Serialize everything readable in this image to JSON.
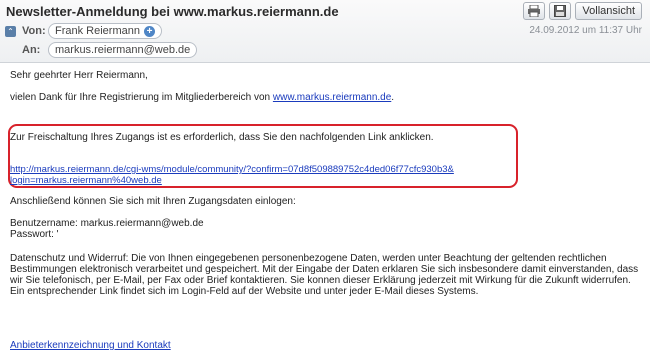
{
  "header": {
    "subject": "Newsletter-Anmeldung bei www.markus.reiermann.de",
    "print_icon": "printer-icon",
    "save_icon": "save-icon",
    "fullview_label": "Vollansicht",
    "von_label": "Von:",
    "sender": "Frank Reiermann",
    "an_label": "An:",
    "recipient": "markus.reiermann@web.de",
    "date": "24.09.2012 um 11:37 Uhr"
  },
  "body": {
    "salutation": "Sehr geehrter Herr Reiermann,",
    "thanks_prefix": "vielen Dank für Ihre Registrierung im Mitgliederbereich von ",
    "thanks_link": "www.markus.reiermann.de",
    "thanks_suffix": ".",
    "activation_text": "Zur Freischaltung Ihres Zugangs ist es erforderlich, dass Sie den nachfolgenden Link anklicken.",
    "activation_link_line1": "http://markus.reiermann.de/cgi-wms/module/community/?confirm=07d8f509889752c4ded06f77cfc930b3&",
    "activation_link_line2": "login=markus.reiermann%40web.de",
    "login_text": "Anschließend können Sie sich mit Ihren Zugangsdaten einlogen:",
    "username_line": "Benutzername: markus.reiermann@web.de",
    "password_line": "Passwort: '",
    "privacy_text": "Datenschutz und Widerruf: Die von Ihnen eingegebenen personenbezogene Daten, werden unter Beachtung der geltenden rechtlichen Bestimmungen elektronisch verarbeitet und gespeichert. Mit der Eingabe der Daten erklaren Sie sich insbesondere damit einverstanden, dass wir Sie telefonisch, per E-Mail, per Fax oder Brief kontaktieren. Sie konnen dieser Erklärung jederzeit mit Wirkung für die Zukunft widerrufen. Ein entsprechender Link findet sich im Login-Feld auf der Website und unter jeder E-Mail dieses Systems.",
    "imprint_link": "Anbieterkennzeichnung und Kontakt"
  },
  "colors": {
    "highlight_border": "#d8222b",
    "link": "#1a3bbd"
  }
}
